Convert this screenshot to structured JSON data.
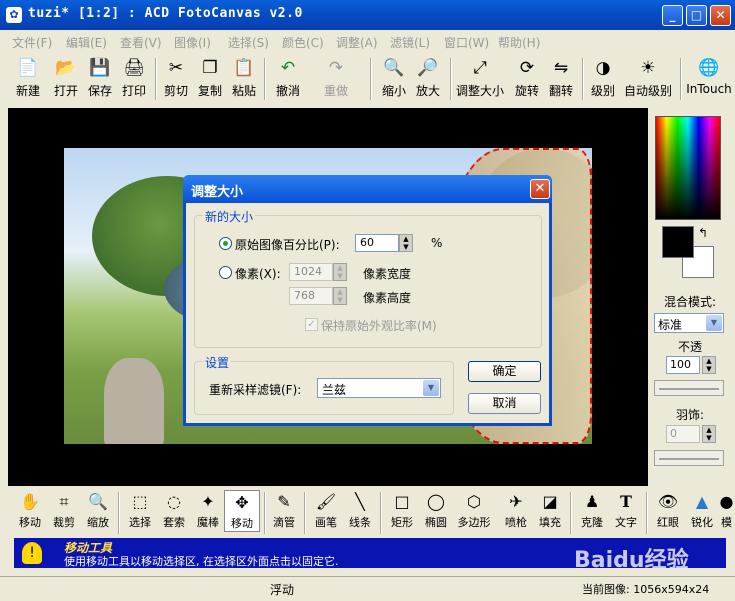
{
  "window": {
    "title": "tuzi* [1:2] : ACD FotoCanvas v2.0",
    "min": "_",
    "max": "□",
    "close": "✕"
  },
  "menu": [
    "文件(F)",
    "编辑(E)",
    "查看(V)",
    "图像(I)",
    "选择(S)",
    "颜色(C)",
    "调整(A)",
    "滤镜(L)",
    "窗口(W)",
    "帮助(H)"
  ],
  "toolbar": [
    {
      "label": "新建",
      "icon": "new-file-icon",
      "glyph": "📄"
    },
    {
      "label": "打开",
      "icon": "open-folder-icon",
      "glyph": "📂"
    },
    {
      "label": "保存",
      "icon": "save-icon",
      "glyph": "💾"
    },
    {
      "label": "打印",
      "icon": "print-icon",
      "glyph": "🖨"
    },
    {
      "label": "剪切",
      "icon": "cut-icon",
      "glyph": "✂"
    },
    {
      "label": "复制",
      "icon": "copy-icon",
      "glyph": "❐"
    },
    {
      "label": "粘贴",
      "icon": "paste-icon",
      "glyph": "📋"
    },
    {
      "label": "撤消",
      "icon": "undo-icon",
      "glyph": "↶"
    },
    {
      "label": "重做",
      "icon": "redo-icon",
      "glyph": "↷"
    },
    {
      "label": "缩小",
      "icon": "zoom-out-icon",
      "glyph": "🔍"
    },
    {
      "label": "放大",
      "icon": "zoom-in-icon",
      "glyph": "🔎"
    },
    {
      "label": "调整大小",
      "icon": "resize-icon",
      "glyph": "⤢"
    },
    {
      "label": "旋转",
      "icon": "rotate-icon",
      "glyph": "⟳"
    },
    {
      "label": "翻转",
      "icon": "flip-icon",
      "glyph": "⇋"
    },
    {
      "label": "级别",
      "icon": "levels-icon",
      "glyph": "◑"
    },
    {
      "label": "自动级别",
      "icon": "auto-levels-icon",
      "glyph": "☀"
    },
    {
      "label": "InTouch",
      "icon": "intouch-icon",
      "glyph": "🌐"
    }
  ],
  "panel": {
    "blend_label": "混合模式:",
    "blend_value": "标准",
    "opacity_label": "不透",
    "opacity_value": "100",
    "feather_label": "羽饰:",
    "feather_value": "0"
  },
  "tools": [
    {
      "label": "移动",
      "icon": "hand-icon",
      "glyph": "✋"
    },
    {
      "label": "裁剪",
      "icon": "crop-icon",
      "glyph": "⌗"
    },
    {
      "label": "缩放",
      "icon": "zoom-icon",
      "glyph": "🔍"
    },
    {
      "label": "选择",
      "icon": "rect-select-icon",
      "glyph": "⬚"
    },
    {
      "label": "套索",
      "icon": "lasso-icon",
      "glyph": "◌"
    },
    {
      "label": "魔棒",
      "icon": "magic-wand-icon",
      "glyph": "✦"
    },
    {
      "label": "移动",
      "icon": "move-icon",
      "glyph": "✥"
    },
    {
      "label": "滴管",
      "icon": "eyedropper-icon",
      "glyph": "✎"
    },
    {
      "label": "画笔",
      "icon": "brush-icon",
      "glyph": "🖌"
    },
    {
      "label": "线条",
      "icon": "line-icon",
      "glyph": "╲"
    },
    {
      "label": "矩形",
      "icon": "rectangle-icon",
      "glyph": "□"
    },
    {
      "label": "椭圆",
      "icon": "ellipse-icon",
      "glyph": "◯"
    },
    {
      "label": "多边形",
      "icon": "polygon-icon",
      "glyph": "⬡"
    },
    {
      "label": "喷枪",
      "icon": "airbrush-icon",
      "glyph": "✈"
    },
    {
      "label": "填充",
      "icon": "fill-icon",
      "glyph": "◪"
    },
    {
      "label": "克隆",
      "icon": "clone-icon",
      "glyph": "♟"
    },
    {
      "label": "文字",
      "icon": "text-icon",
      "glyph": "T"
    },
    {
      "label": "红眼",
      "icon": "red-eye-icon",
      "glyph": "👁"
    },
    {
      "label": "锐化",
      "icon": "sharpen-icon",
      "glyph": "▲"
    },
    {
      "label": "模",
      "icon": "blur-icon",
      "glyph": "●"
    }
  ],
  "status": {
    "title": "移动工具",
    "message": "使用移动工具以移动选择区, 在选择区外面点击以固定它.",
    "watermark": "Baidu经验"
  },
  "bottom": {
    "mode": "浮动",
    "info": "当前图像: 1056x594x24"
  },
  "dialog": {
    "title": "调整大小",
    "close": "✕",
    "group_new_size": "新的大小",
    "percent_label": "原始图像百分比(P):",
    "percent_value": "60",
    "percent_unit": "%",
    "pixel_label": "像素(X):",
    "width_value": "1024",
    "width_label": "像素宽度",
    "height_value": "768",
    "height_label": "像素高度",
    "keep_ratio_label": "保持原始外观比率(M)",
    "group_settings": "设置",
    "filter_label": "重新采样滤镜(F):",
    "filter_value": "兰兹",
    "ok": "确定",
    "cancel": "取消"
  },
  "colors": {
    "title_bar": "#0a4ccc",
    "status_bg": "#0a14b0",
    "accent_green": "#21a121"
  }
}
